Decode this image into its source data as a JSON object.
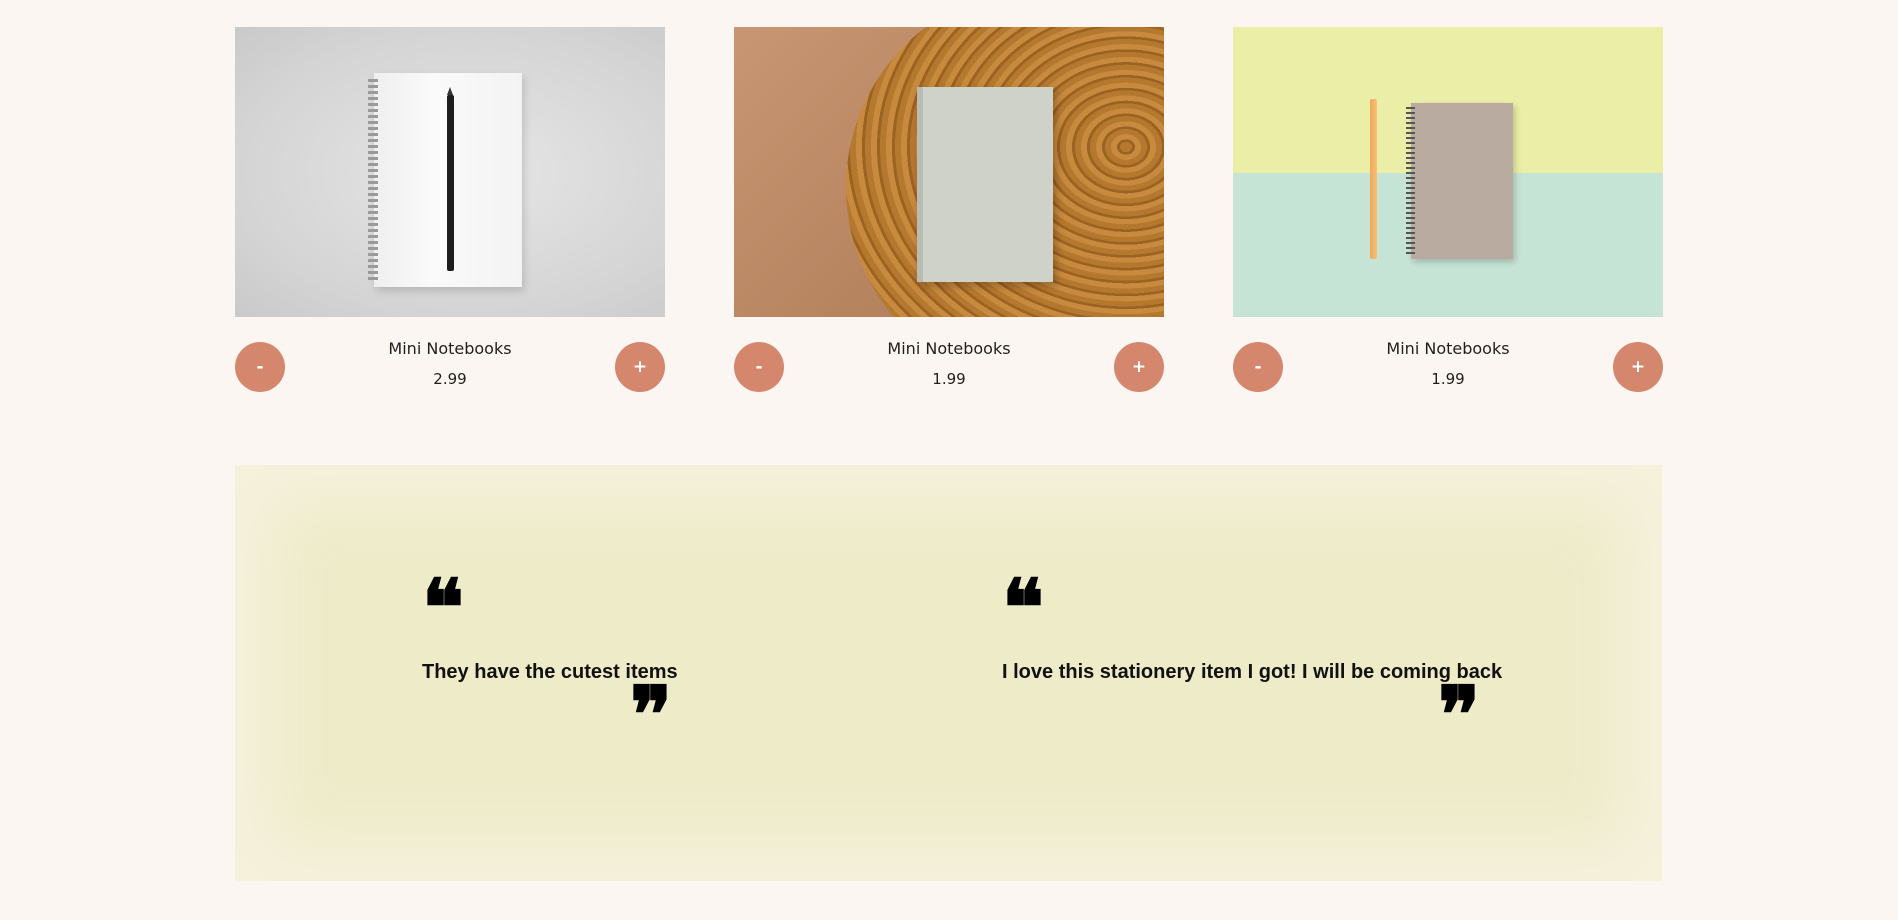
{
  "products": [
    {
      "name": "Mini Notebooks",
      "price": "2.99",
      "image": "white-notebook-with-black-pencil",
      "minus_label": "-",
      "plus_label": "+"
    },
    {
      "name": "Mini Notebooks",
      "price": "1.99",
      "image": "gray-notebook-on-wooden-table",
      "minus_label": "-",
      "plus_label": "+"
    },
    {
      "name": "Mini Notebooks",
      "price": "1.99",
      "image": "spiral-notebook-with-orange-pencil",
      "minus_label": "-",
      "plus_label": "+"
    }
  ],
  "testimonials": [
    {
      "open_mark": "❝",
      "text": "They have the cutest items",
      "close_mark": "❞"
    },
    {
      "open_mark": "❝",
      "text": "I love this stationery item I got! I will be coming back",
      "close_mark": "❞"
    }
  ],
  "colors": {
    "page_background": "#fcf6f2",
    "button_accent": "#d4876d",
    "testimonial_background": "#eeebc9"
  }
}
